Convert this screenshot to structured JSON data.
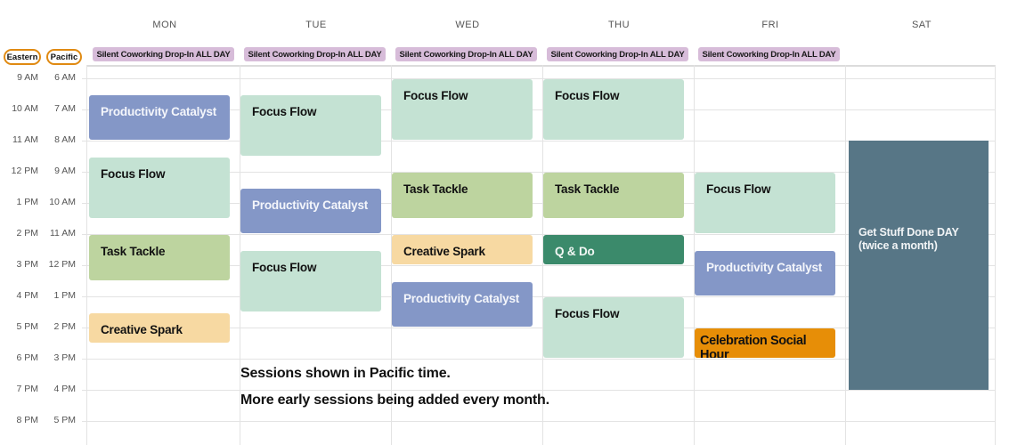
{
  "timezones": {
    "eastern_label": "Eastern",
    "pacific_label": "Pacific"
  },
  "days": [
    "MON",
    "TUE",
    "WED",
    "THU",
    "FRI",
    "SAT"
  ],
  "all_day_event": "Silent Coworking Drop-In ALL DAY",
  "all_day_days": [
    "MON",
    "TUE",
    "WED",
    "THU",
    "FRI"
  ],
  "times": [
    {
      "eastern": "9 AM",
      "pacific": "6 AM"
    },
    {
      "eastern": "10 AM",
      "pacific": "7 AM"
    },
    {
      "eastern": "11 AM",
      "pacific": "8 AM"
    },
    {
      "eastern": "12 PM",
      "pacific": "9 AM"
    },
    {
      "eastern": "1 PM",
      "pacific": "10 AM"
    },
    {
      "eastern": "2 PM",
      "pacific": "11 AM"
    },
    {
      "eastern": "3 PM",
      "pacific": "12 PM"
    },
    {
      "eastern": "4 PM",
      "pacific": "1 PM"
    },
    {
      "eastern": "5 PM",
      "pacific": "2 PM"
    },
    {
      "eastern": "6 PM",
      "pacific": "3 PM"
    },
    {
      "eastern": "7 PM",
      "pacific": "4 PM"
    },
    {
      "eastern": "8 PM",
      "pacific": "5 PM"
    }
  ],
  "events": [
    {
      "day": 0,
      "title": "Productivity Catalyst",
      "type": "productivity",
      "start": 0.5,
      "end": 2.0
    },
    {
      "day": 0,
      "title": "Focus Flow",
      "type": "focus",
      "start": 2.5,
      "end": 4.5
    },
    {
      "day": 0,
      "title": "Task Tackle",
      "type": "task",
      "start": 5.0,
      "end": 6.5
    },
    {
      "day": 0,
      "title": "Creative Spark",
      "type": "creative",
      "start": 7.5,
      "end": 8.5
    },
    {
      "day": 1,
      "title": "Focus Flow",
      "type": "focus",
      "start": 0.5,
      "end": 2.5
    },
    {
      "day": 1,
      "title": "Productivity Catalyst",
      "type": "productivity",
      "start": 3.5,
      "end": 5.0
    },
    {
      "day": 1,
      "title": "Focus Flow",
      "type": "focus",
      "start": 5.5,
      "end": 7.5
    },
    {
      "day": 2,
      "title": "Focus Flow",
      "type": "focus",
      "start": 0.0,
      "end": 2.0
    },
    {
      "day": 2,
      "title": "Task Tackle",
      "type": "task",
      "start": 3.0,
      "end": 4.5
    },
    {
      "day": 2,
      "title": "Creative Spark",
      "type": "creative",
      "start": 5.0,
      "end": 6.0
    },
    {
      "day": 2,
      "title": "Productivity Catalyst",
      "type": "productivity",
      "start": 6.5,
      "end": 8.0
    },
    {
      "day": 3,
      "title": "Focus Flow",
      "type": "focus",
      "start": 0.0,
      "end": 2.0
    },
    {
      "day": 3,
      "title": "Task Tackle",
      "type": "task",
      "start": 3.0,
      "end": 4.5
    },
    {
      "day": 3,
      "title": "Q & Do",
      "type": "qdo",
      "start": 5.0,
      "end": 6.0
    },
    {
      "day": 3,
      "title": "Focus Flow",
      "type": "focus",
      "start": 7.0,
      "end": 9.0
    },
    {
      "day": 4,
      "title": "Focus Flow",
      "type": "focus",
      "start": 3.0,
      "end": 5.0
    },
    {
      "day": 4,
      "title": "Productivity Catalyst",
      "type": "productivity",
      "start": 5.5,
      "end": 7.0
    },
    {
      "day": 4,
      "title": "Celebration Social Hour",
      "type": "celebration",
      "start": 8.0,
      "end": 9.0
    },
    {
      "day": 5,
      "title": "Get Stuff Done DAY (twice a month)",
      "type": "gsd",
      "start": 2.0,
      "end": 10.0
    }
  ],
  "notes": [
    "Sessions shown in Pacific time.",
    "More early sessions being added every month."
  ],
  "colors": {
    "focus": "#c4e2d3",
    "productivity": "#8497c7",
    "task": "#bdd49f",
    "creative": "#f7d9a2",
    "qdo": "#3b8a6b",
    "celebration": "#e78e07",
    "gsd": "#577686",
    "all_day": "#d7bcd9",
    "timezone_ring": "#e08a12"
  }
}
